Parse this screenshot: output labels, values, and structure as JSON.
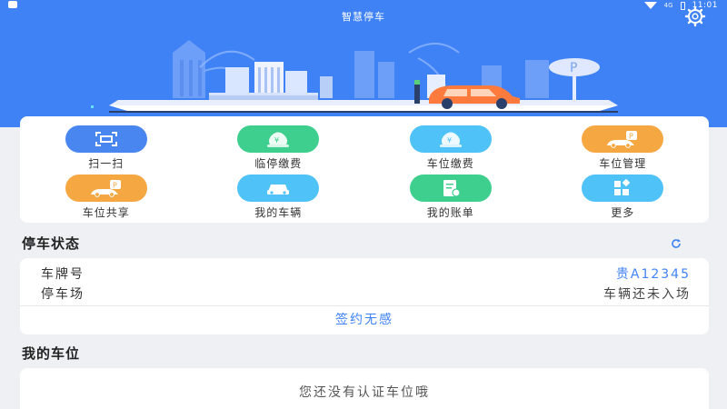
{
  "status_bar": {
    "time": "11:01",
    "signal_label": "4G"
  },
  "header": {
    "title": "智慧停车"
  },
  "icons": {
    "settings": "gear-icon",
    "scan": "scan-icon",
    "temp_pay": "coin-bag-icon",
    "space_pay": "coin-bag-icon",
    "space_manage": "car-parking-icon",
    "space_share": "car-parking-icon",
    "my_vehicles": "car-icon",
    "my_bills": "bill-icon",
    "more": "grid-icon",
    "refresh": "refresh-icon"
  },
  "colors": {
    "primary": "#3f82f6",
    "scan": "#4a86f0",
    "green": "#3ecf8f",
    "cyan": "#4fc3f7",
    "orange": "#f5a742"
  },
  "functions": [
    {
      "label": "扫一扫"
    },
    {
      "label": "临停缴费"
    },
    {
      "label": "车位缴费"
    },
    {
      "label": "车位管理"
    },
    {
      "label": "车位共享"
    },
    {
      "label": "我的车辆"
    },
    {
      "label": "我的账单"
    },
    {
      "label": "更多"
    }
  ],
  "parking_status": {
    "title": "停车状态",
    "plate_label": "车牌号",
    "plate_value": "贵A12345",
    "lot_label": "停车场",
    "lot_value": "车辆还未入场",
    "sign_button": "签约无感"
  },
  "my_space": {
    "title": "我的车位",
    "empty_message": "您还没有认证车位哦"
  }
}
